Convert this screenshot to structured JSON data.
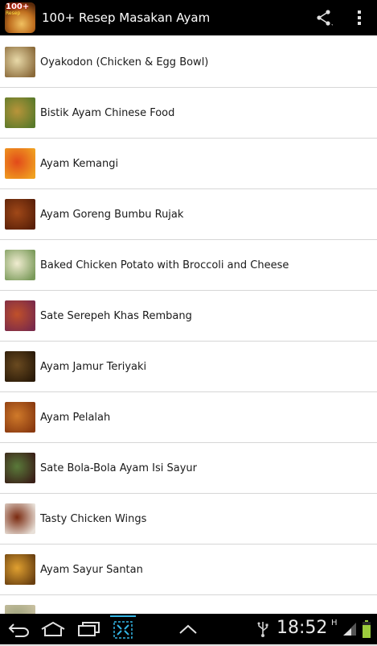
{
  "app": {
    "title": "100+ Resep Masakan Ayam",
    "icon_badge": "100+",
    "icon_badge_sub": "Resep"
  },
  "actionbar": {
    "share_icon": "share-icon",
    "overflow_icon": "overflow-menu-icon"
  },
  "recipes": [
    {
      "label": "Oyakodon (Chicken & Egg Bowl)",
      "thumb_colors": [
        "#e8d9a8",
        "#8a6a3a"
      ]
    },
    {
      "label": "Bistik Ayam Chinese Food",
      "thumb_colors": [
        "#b8943a",
        "#5a7a2a"
      ]
    },
    {
      "label": "Ayam Kemangi",
      "thumb_colors": [
        "#e24a1a",
        "#f0a020"
      ]
    },
    {
      "label": "Ayam Goreng Bumbu Rujak",
      "thumb_colors": [
        "#a04818",
        "#5a2008"
      ]
    },
    {
      "label": "Baked Chicken Potato with Broccoli and Cheese",
      "thumb_colors": [
        "#f0ecd0",
        "#7a9a5a"
      ]
    },
    {
      "label": "Sate Serepeh Khas Rembang",
      "thumb_colors": [
        "#c0502a",
        "#7a2a4a"
      ]
    },
    {
      "label": "Ayam Jamur Teriyaki",
      "thumb_colors": [
        "#6a4a20",
        "#2a1a08"
      ]
    },
    {
      "label": "Ayam Pelalah",
      "thumb_colors": [
        "#d07a2a",
        "#8a3a10"
      ]
    },
    {
      "label": "Sate Bola-Bola Ayam Isi Sayur",
      "thumb_colors": [
        "#5a7a3a",
        "#3a2018"
      ]
    },
    {
      "label": "Tasty Chicken Wings",
      "thumb_colors": [
        "#7a2a10",
        "#e8e0d8"
      ]
    },
    {
      "label": "Ayam Sayur Santan",
      "thumb_colors": [
        "#e0a030",
        "#6a4010"
      ]
    },
    {
      "label": "",
      "thumb_colors": [
        "#9aa07a",
        "#c8c0a0"
      ]
    }
  ],
  "statusbar": {
    "time": "18:52",
    "network": "H",
    "usb_icon": "usb-icon",
    "signal_icon": "signal-icon",
    "battery_icon": "battery-icon"
  },
  "navbar": {
    "back_icon": "back-icon",
    "home_icon": "home-icon",
    "recents_icon": "recents-icon",
    "screenshot_icon": "screenshot-icon",
    "up_icon": "chevron-up-icon"
  }
}
